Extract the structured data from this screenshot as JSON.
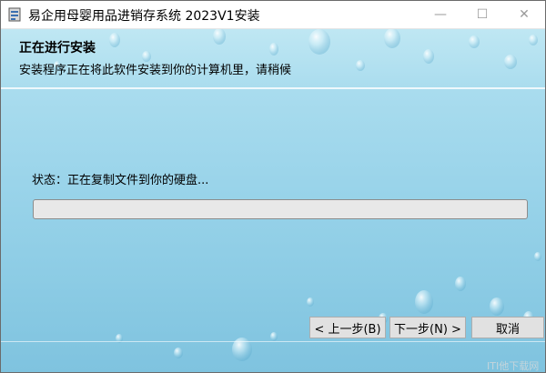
{
  "window": {
    "title": "易企用母婴用品进销存系统 2023V1安装",
    "controls": {
      "minimize": "—",
      "maximize": "☐",
      "close": "✕"
    }
  },
  "header": {
    "title": "正在进行安装",
    "subtitle": "安装程序正在将此软件安装到你的计算机里，请稍候"
  },
  "status": {
    "text": "状态：正在复制文件到你的硬盘..."
  },
  "progress": {
    "fraction": 0.0
  },
  "buttons": {
    "back": "< 上一步(B)",
    "next": "下一步(N) >",
    "cancel": "取消"
  },
  "watermark": "ITI他下载网",
  "icons": {
    "app": "installer-icon",
    "minimize": "minimize-icon",
    "maximize": "maximize-icon",
    "close": "close-icon"
  },
  "colors": {
    "background_top": "#bfe7f3",
    "background_bottom": "#7fc3df",
    "progress_fill": "#06b025"
  }
}
